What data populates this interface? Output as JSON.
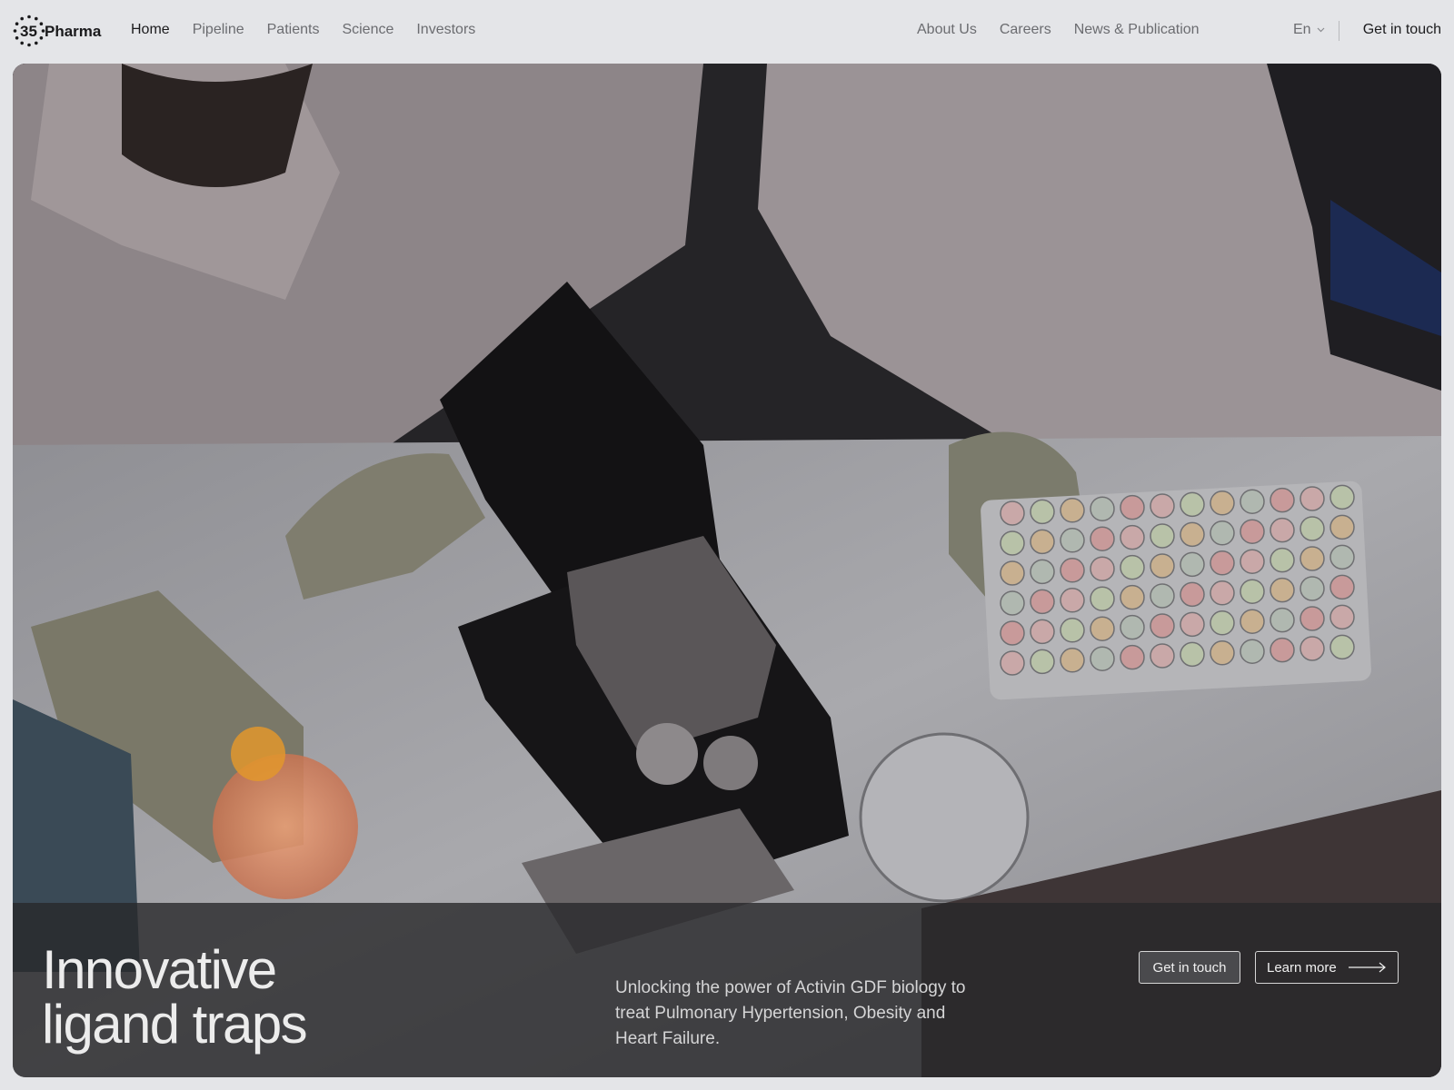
{
  "brand": {
    "logo_number": "35",
    "logo_word": "Pharma"
  },
  "nav": {
    "left": [
      {
        "label": "Home",
        "active": true
      },
      {
        "label": "Pipeline",
        "active": false
      },
      {
        "label": "Patients",
        "active": false
      },
      {
        "label": "Science",
        "active": false
      },
      {
        "label": "Investors",
        "active": false
      }
    ],
    "right": [
      {
        "label": "About Us"
      },
      {
        "label": "Careers"
      },
      {
        "label": "News & Publication"
      }
    ],
    "language": "En",
    "cta": "Get in touch"
  },
  "hero": {
    "title_line1": "Innovative",
    "title_line2": "ligand traps",
    "description": "Unlocking the power of Activin GDF biology to treat Pulmonary Hypertension, Obesity and Heart Failure.",
    "primary_button": "Get in touch",
    "secondary_button": "Learn more"
  },
  "colors": {
    "page_background": "#e4e5e8",
    "text_dark": "#1b1b1d",
    "text_muted": "#6b6c70",
    "overlay": "#28282a"
  },
  "icons": [
    "chevron-down-icon",
    "arrow-right-icon",
    "dotted-circle-logo-icon"
  ]
}
